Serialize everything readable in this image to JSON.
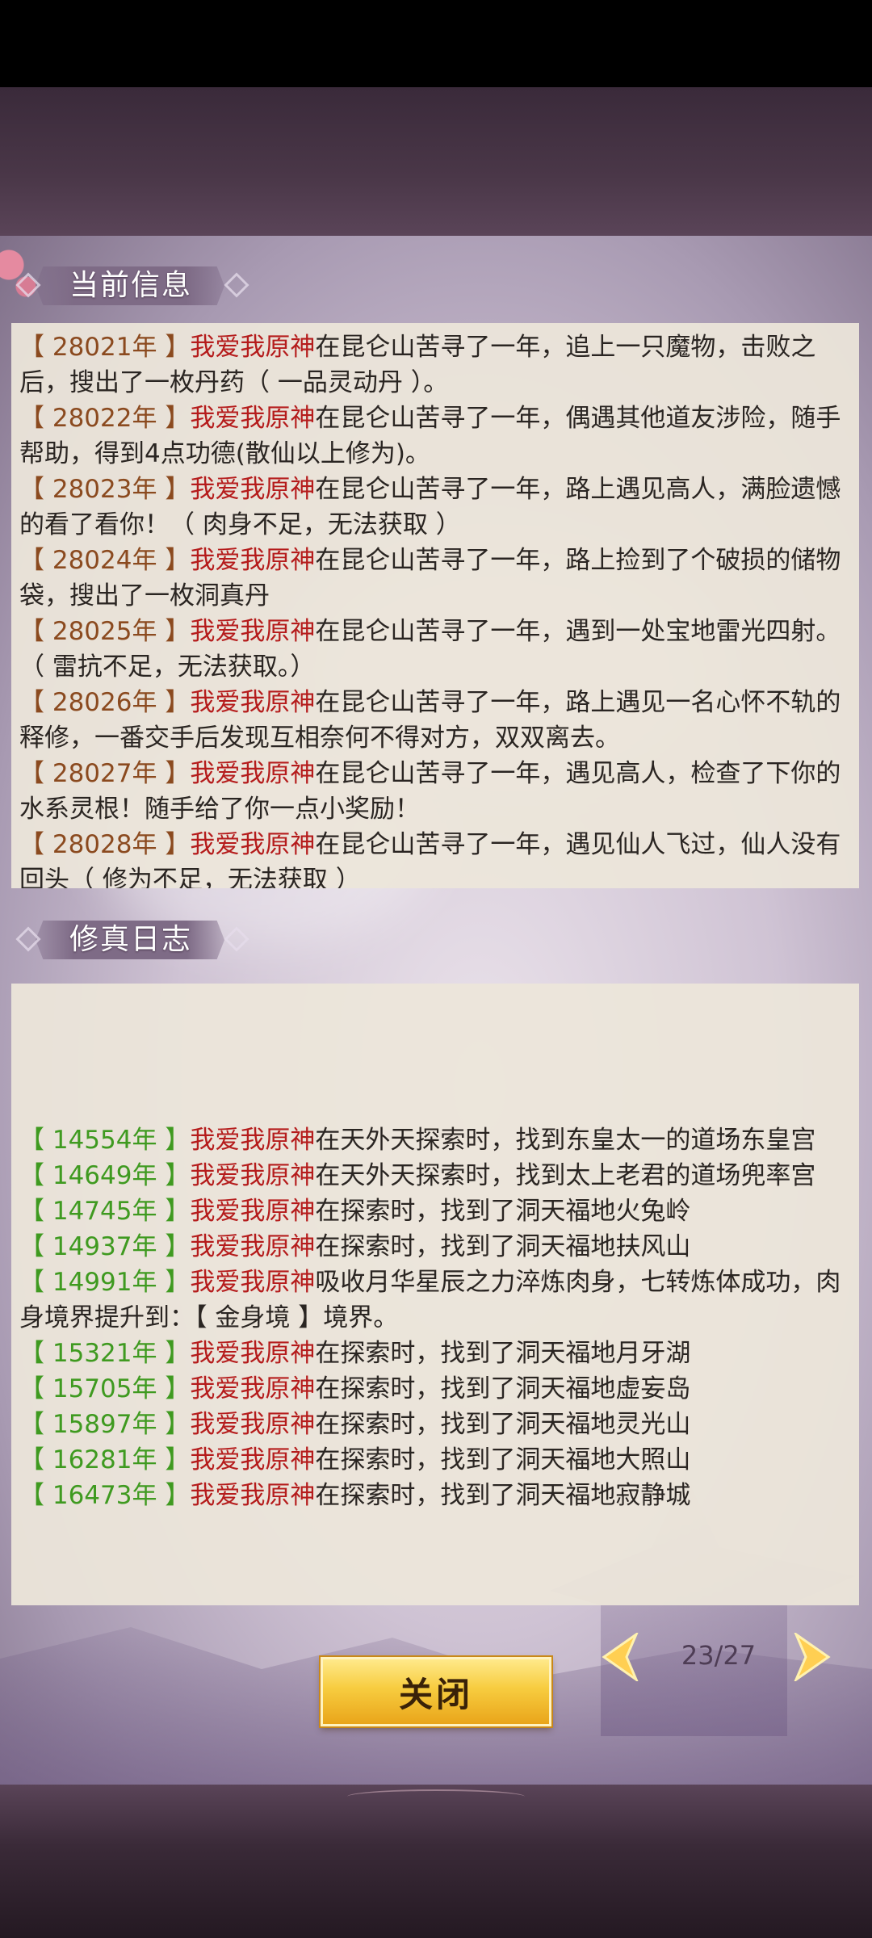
{
  "sections": {
    "current_info_title": "当前信息",
    "log_title": "修真日志"
  },
  "current_info": [
    {
      "year": "【 28021年 】",
      "name": "我爱我原神",
      "text": "在昆仑山苦寻了一年，追上一只魔物，击败之后，搜出了一枚丹药（ 一品灵动丹 ）。"
    },
    {
      "year": "【 28022年 】",
      "name": "我爱我原神",
      "text": "在昆仑山苦寻了一年，偶遇其他道友涉险，随手帮助，得到4点功德(散仙以上修为)。"
    },
    {
      "year": "【 28023年 】",
      "name": "我爱我原神",
      "text": "在昆仑山苦寻了一年，路上遇见高人，满脸遗憾的看了看你！（ 肉身不足，无法获取 ）"
    },
    {
      "year": "【 28024年 】",
      "name": "我爱我原神",
      "text": "在昆仑山苦寻了一年，路上捡到了个破损的储物袋，搜出了一枚洞真丹"
    },
    {
      "year": "【 28025年 】",
      "name": "我爱我原神",
      "text": "在昆仑山苦寻了一年，遇到一处宝地雷光四射。（ 雷抗不足，无法获取。）"
    },
    {
      "year": "【 28026年 】",
      "name": "我爱我原神",
      "text": "在昆仑山苦寻了一年，路上遇见一名心怀不轨的释修，一番交手后发现互相奈何不得对方，双双离去。"
    },
    {
      "year": "【 28027年 】",
      "name": "我爱我原神",
      "text": "在昆仑山苦寻了一年，遇见高人，检查了下你的水系灵根！随手给了你一点小奖励！"
    },
    {
      "year": "【 28028年 】",
      "name": "我爱我原神",
      "text": "在昆仑山苦寻了一年，遇见仙人飞过，仙人没有回头（ 修为不足，无法获取 ）"
    }
  ],
  "cultivation_log": [
    {
      "year": "【 14554年 】",
      "name": "我爱我原神",
      "text": "在天外天探索时，找到东皇太一的道场东皇宫"
    },
    {
      "year": "【 14649年 】",
      "name": "我爱我原神",
      "text": "在天外天探索时，找到太上老君的道场兜率宫"
    },
    {
      "year": "【 14745年 】",
      "name": "我爱我原神",
      "text": "在探索时，找到了洞天福地火兔岭"
    },
    {
      "year": "【 14937年 】",
      "name": "我爱我原神",
      "text": "在探索时，找到了洞天福地扶风山"
    },
    {
      "year": "【 14991年 】",
      "name": "我爱我原神",
      "text": "吸收月华星辰之力淬炼肉身，七转炼体成功，肉身境界提升到：【 金身境 】境界。"
    },
    {
      "year": "【 15321年 】",
      "name": "我爱我原神",
      "text": "在探索时，找到了洞天福地月牙湖"
    },
    {
      "year": "【 15705年 】",
      "name": "我爱我原神",
      "text": "在探索时，找到了洞天福地虚妄岛"
    },
    {
      "year": "【 15897年 】",
      "name": "我爱我原神",
      "text": "在探索时，找到了洞天福地灵光山"
    },
    {
      "year": "【 16281年 】",
      "name": "我爱我原神",
      "text": "在探索时，找到了洞天福地大照山"
    },
    {
      "year": "【 16473年 】",
      "name": "我爱我原神",
      "text": "在探索时，找到了洞天福地寂静城"
    }
  ],
  "footer": {
    "close_label": "关闭",
    "page_indicator": "23/27",
    "prev_icon": "chevron-left-icon",
    "next_icon": "chevron-right-icon"
  },
  "colors": {
    "name_red": "#b51c1c",
    "year_brown": "#8b4a1f",
    "year_green": "#3f9a20",
    "button_gold": "#f7cc3f"
  }
}
